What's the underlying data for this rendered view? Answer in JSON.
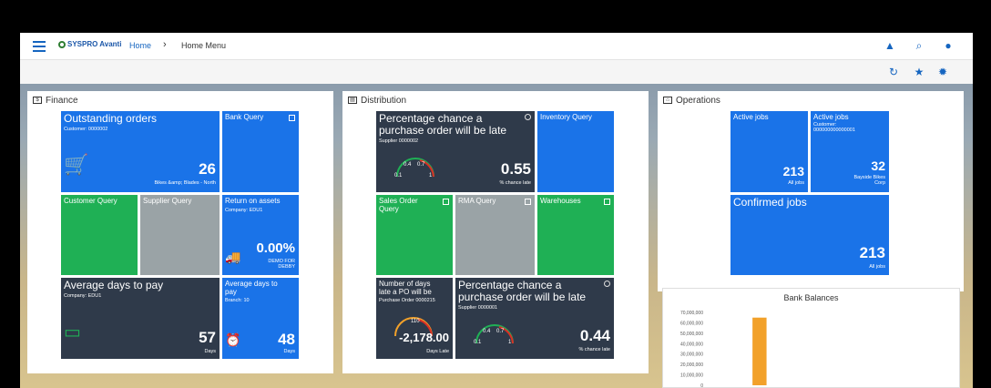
{
  "breadcrumb": {
    "home": "Home",
    "current": "Home Menu"
  },
  "logo": "SYSPRO Avanti",
  "icons": {
    "menu": "hamburger-icon",
    "bell": "bell-icon",
    "search": "search-icon",
    "user": "user-icon",
    "refresh": "refresh-icon",
    "star": "star-icon",
    "settings": "gear-icon"
  },
  "panels": {
    "finance": "Finance",
    "distribution": "Distribution",
    "operations": "Operations"
  },
  "finance": {
    "outstanding": {
      "title": "Outstanding orders",
      "sub": "Customer: 0000002",
      "value": "26",
      "label": "Bikes &amp; Blades - North"
    },
    "bank_query": "Bank Query",
    "customer_query": "Customer Query",
    "supplier_query": "Supplier Query",
    "roa": {
      "title": "Return on assets",
      "sub": "Company: EDU1",
      "value": "0.00%",
      "label1": "DEMO FOR",
      "label2": "DEBBY"
    },
    "avg_days": {
      "title": "Average days to pay",
      "sub": "Company: EDU1",
      "value": "57",
      "label": "Days"
    },
    "avg_days_small": {
      "title1": "Average days to",
      "title2": "pay",
      "sub": "Branch: 10",
      "value": "48",
      "label": "Days"
    }
  },
  "distribution": {
    "pct1": {
      "title1": "Percentage chance a",
      "title2": "purchase order will be late",
      "sub": "Supplier 0000002",
      "value": "0.55",
      "label": "% chance late",
      "g1": "0.4",
      "g2": "0.7",
      "g3": "0.1",
      "g4": "1"
    },
    "inventory": "Inventory Query",
    "sales1": "Sales Order",
    "sales2": "Query",
    "rma": "RMA Query",
    "warehouses": "Warehouses",
    "days": {
      "title1": "Number of days",
      "title2": "late a PO will be",
      "sub": "Purchase Order 0000215",
      "g": "110",
      "value": "-2,178.00",
      "label": "Days Late"
    },
    "pct2": {
      "title1": "Percentage chance a",
      "title2": "purchase order will be late",
      "sub": "Supplier 0000001",
      "value": "0.44",
      "label": "% chance late",
      "g1": "0.4",
      "g2": "0.7",
      "g3": "0.1",
      "g4": "1"
    }
  },
  "operations": {
    "active1": {
      "title": "Active jobs",
      "value": "213",
      "label": "All jobs"
    },
    "active2": {
      "title": "Active jobs",
      "sub1": "Customer:",
      "sub2": "000000000000001",
      "value": "32",
      "label1": "Bayside Bikes",
      "label2": "Corp"
    },
    "confirmed": {
      "title": "Confirmed jobs",
      "value": "213",
      "label": "All jobs"
    }
  },
  "chart_data": {
    "type": "bar",
    "title": "Bank Balances",
    "yticks": [
      "70,000,000",
      "60,000,000",
      "50,000,000",
      "40,000,000",
      "30,000,000",
      "20,000,000",
      "10,000,000",
      "0"
    ],
    "ylim": [
      0,
      70000000
    ],
    "values": [
      0,
      65000000,
      0,
      0,
      0,
      0,
      0
    ],
    "bar_color": "#f2a12a"
  }
}
